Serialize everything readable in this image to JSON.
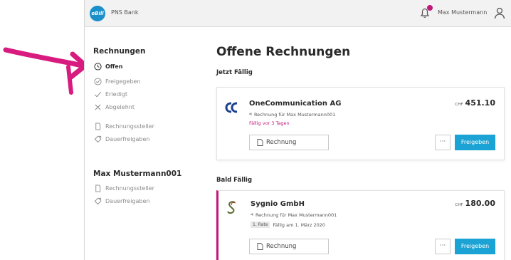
{
  "topbar": {
    "logo_text": "eBill",
    "bank": "PNS Bank",
    "user": "Max Mustermann",
    "bell_icon": "bell-icon",
    "user_icon": "user-icon"
  },
  "sidebar": {
    "section1": "Rechnungen",
    "items": [
      {
        "label": "Offen",
        "icon": "clock-icon",
        "active": true
      },
      {
        "label": "Freigegeben",
        "icon": "clock-check-icon"
      },
      {
        "label": "Erledigt",
        "icon": "check-icon"
      },
      {
        "label": "Abgelehnt",
        "icon": "x-icon"
      },
      {
        "label": "Rechnungssteller",
        "icon": "document-icon"
      },
      {
        "label": "Dauerfreigaben",
        "icon": "tag-icon"
      }
    ],
    "section2": "Max Mustermann001",
    "items2": [
      {
        "label": "Rechnungssteller",
        "icon": "document-icon"
      },
      {
        "label": "Dauerfreigaben",
        "icon": "tag-icon"
      }
    ]
  },
  "main": {
    "title": "Offene Rechnungen",
    "section_now": "Jetzt Fällig",
    "section_soon": "Bald Fällig",
    "bills": [
      {
        "company": "OneCommunication AG",
        "shared": "Rechnung für Max Mustermann001",
        "due": "Fällig vor 3 Tagen",
        "currency": "CHF",
        "amount": "451.10",
        "btn_invoice": "Rechnung",
        "btn_more": "···",
        "btn_approve": "Freigeben"
      },
      {
        "company": "Sygnio GmbH",
        "shared": "Rechnung für Max Mustermann001",
        "rate": "1. Rate",
        "due": "Fällig am 1. März 2020",
        "currency": "CHF",
        "amount": "180.00",
        "btn_invoice": "Rechnung",
        "btn_more": "···",
        "btn_approve": "Freigeben"
      }
    ]
  },
  "colors": {
    "accent": "#1aa3d4",
    "highlight": "#c2177a",
    "logo": "#1a8fc9"
  }
}
